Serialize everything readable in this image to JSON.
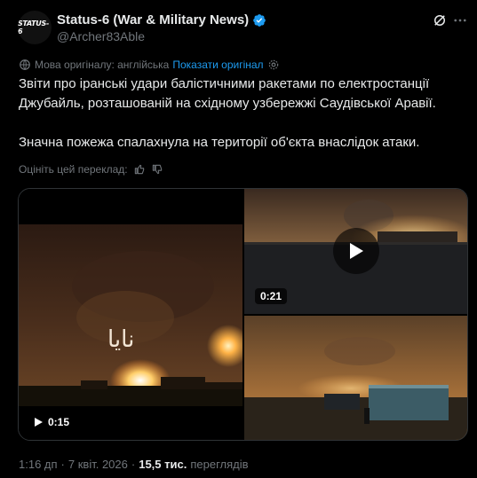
{
  "author": {
    "avatar_text": "STATUS-6",
    "display_name": "Status-6 (War & Military News)",
    "handle": "@Archer83Able"
  },
  "translation": {
    "notice": "Мова оригіналу: англійська",
    "show_original_label": "Показати оригінал",
    "rate_label": "Оцініть цей переклад:"
  },
  "tweet": {
    "paragraph_1": "Звіти про іранські удари балістичними ракетами по електростанції Джубайль, розташованій на східному узбережжі Саудівської Аравії.",
    "paragraph_2": "Значна пожежа спалахнула на території об'єкта внаслідок атаки."
  },
  "media": {
    "left_video": {
      "duration": "0:15",
      "overlay_text": "نايا"
    },
    "top_right_video": {
      "duration": "0:21"
    }
  },
  "meta": {
    "time": "1:16 дп",
    "separator": "·",
    "date": "7 квіт. 2026",
    "views_count": "15,5 тис.",
    "views_label": "переглядів"
  },
  "icons": {
    "verified": "verified-badge-icon",
    "grok": "grok-icon",
    "more": "more-icon",
    "translate": "translate-icon",
    "settings": "gear-icon",
    "thumbs_up": "thumbs-up-icon",
    "thumbs_down": "thumbs-down-icon",
    "play": "play-icon"
  },
  "colors": {
    "background": "#000000",
    "text": "#e7e9ea",
    "muted": "#71767b",
    "accent": "#1d9bf0",
    "border": "#2f3336"
  }
}
